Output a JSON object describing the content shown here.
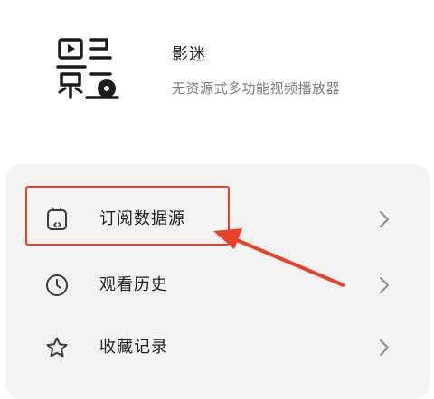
{
  "app": {
    "name": "影迷",
    "description": "无资源式多功能视频播放器"
  },
  "menu": {
    "items": [
      {
        "label": "订阅数据源",
        "icon": "subscription-source-icon"
      },
      {
        "label": "观看历史",
        "icon": "clock-icon"
      },
      {
        "label": "收藏记录",
        "icon": "star-icon"
      }
    ]
  },
  "annotation": {
    "color": "#e8412c",
    "highlighted_item": "订阅数据源"
  },
  "colors": {
    "card_background": "#f3f3f3",
    "text_primary": "#1f1f1f",
    "text_secondary": "#7a7a7a"
  }
}
